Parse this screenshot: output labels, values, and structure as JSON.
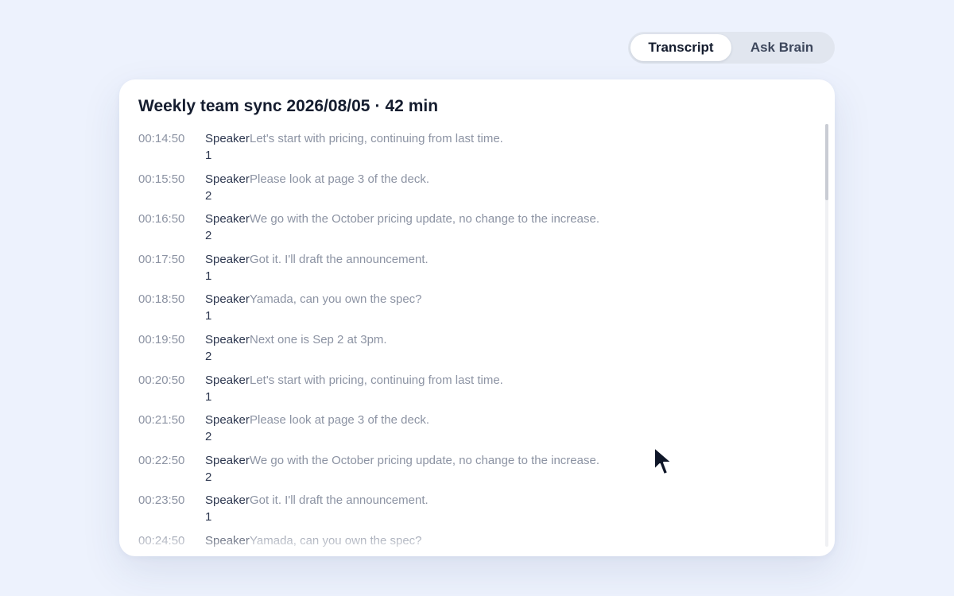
{
  "tabs": [
    {
      "label": "Transcript",
      "active": true
    },
    {
      "label": "Ask Brain",
      "active": false
    }
  ],
  "meeting": {
    "name": "Weekly team sync 2026/08/05",
    "separator": "·",
    "duration": "42 min"
  },
  "transcript": [
    {
      "time": "00:14:50",
      "speaker": "Speaker 1",
      "text": "Let's start with pricing, continuing from last time."
    },
    {
      "time": "00:15:50",
      "speaker": "Speaker 2",
      "text": "Please look at page 3 of the deck."
    },
    {
      "time": "00:16:50",
      "speaker": "Speaker 2",
      "text": "We go with the October pricing update, no change to the increase."
    },
    {
      "time": "00:17:50",
      "speaker": "Speaker 1",
      "text": "Got it. I'll draft the announcement."
    },
    {
      "time": "00:18:50",
      "speaker": "Speaker 1",
      "text": "Yamada, can you own the spec?"
    },
    {
      "time": "00:19:50",
      "speaker": "Speaker 2",
      "text": "Next one is Sep 2 at 3pm."
    },
    {
      "time": "00:20:50",
      "speaker": "Speaker 1",
      "text": "Let's start with pricing, continuing from last time."
    },
    {
      "time": "00:21:50",
      "speaker": "Speaker 2",
      "text": "Please look at page 3 of the deck."
    },
    {
      "time": "00:22:50",
      "speaker": "Speaker 2",
      "text": "We go with the October pricing update, no change to the increase."
    },
    {
      "time": "00:23:50",
      "speaker": "Speaker 1",
      "text": "Got it. I'll draft the announcement."
    },
    {
      "time": "00:24:50",
      "speaker": "Speaker",
      "text": "Yamada, can you own the spec?"
    }
  ],
  "scroll_position": 0.0
}
